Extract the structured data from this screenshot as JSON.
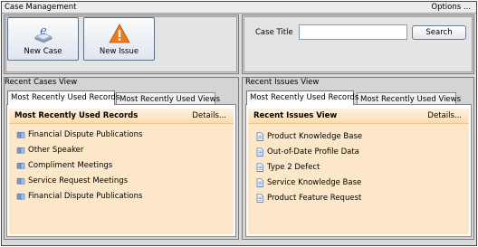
{
  "header": {
    "title": "Case Management",
    "options_label": "Options ..."
  },
  "toolbar": {
    "new_case_label": "New Case",
    "new_issue_label": "New Issue"
  },
  "search": {
    "label": "Case Title",
    "value": "",
    "button_label": "Search"
  },
  "cases_view": {
    "title": "Recent Cases View",
    "tabs": [
      {
        "label": "Most Recently Used Records",
        "active": true
      },
      {
        "label": "Most Recently Used Views",
        "active": false
      }
    ],
    "panel_title": "Most Recently Used Records",
    "details_label": "Details...",
    "items": [
      {
        "label": "Financial Dispute Publications",
        "icon": "book-icon"
      },
      {
        "label": "Other Speaker",
        "icon": "book-icon"
      },
      {
        "label": "Compliment Meetings",
        "icon": "book-icon"
      },
      {
        "label": "Service Request Meetings",
        "icon": "book-icon"
      },
      {
        "label": "Financial Dispute Publications",
        "icon": "book-icon"
      }
    ]
  },
  "issues_view": {
    "title": "Recent Issues View",
    "tabs": [
      {
        "label": "Most Recently Used Records",
        "active": true
      },
      {
        "label": "Most Recently Used Views",
        "active": false
      }
    ],
    "panel_title": "Recent Issues View",
    "details_label": "Details...",
    "items": [
      {
        "label": "Product Knowledge Base",
        "icon": "document-icon"
      },
      {
        "label": "Out-of-Date Profile Data",
        "icon": "document-icon"
      },
      {
        "label": "Type 2 Defect",
        "icon": "document-icon"
      },
      {
        "label": "Service Knowledge Base",
        "icon": "document-icon"
      },
      {
        "label": "Product Feature Request",
        "icon": "document-icon"
      }
    ]
  },
  "colors": {
    "panel_bg": "#fce7c9",
    "header_gradient": "#fbdcae",
    "border": "#7a7a7a"
  }
}
